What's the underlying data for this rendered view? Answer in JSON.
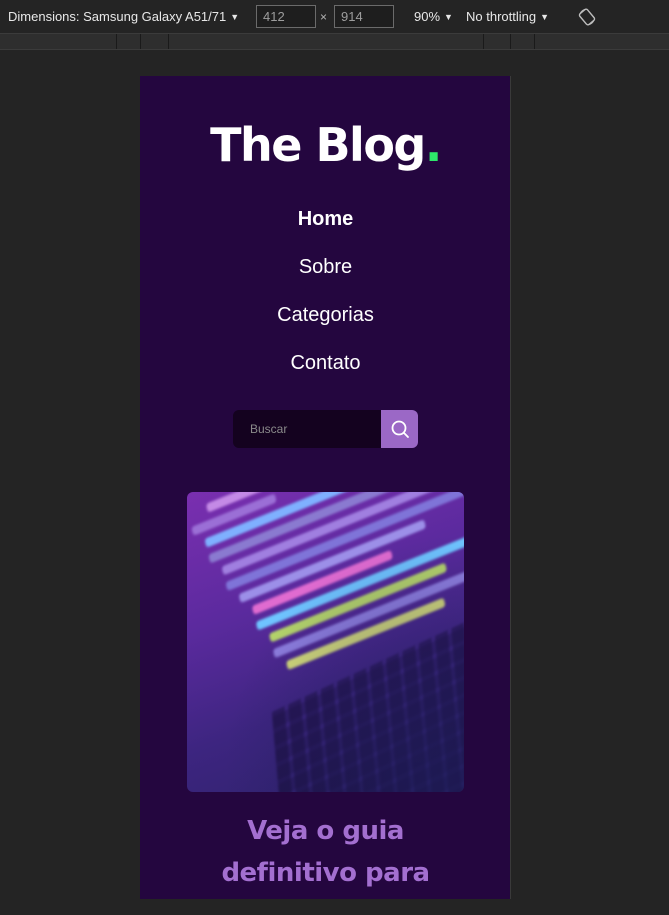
{
  "devtools": {
    "device_label": "Dimensions: Samsung Galaxy A51/71",
    "width_value": "412",
    "height_value": "914",
    "times_sign": "×",
    "zoom": "90%",
    "throttling": "No throttling",
    "caret": "▼",
    "rotate_icon": "rotate-icon"
  },
  "site": {
    "logo_text": "The Blog",
    "logo_dot": ".",
    "accent_color": "#2ee66a",
    "nav": [
      {
        "label": "Home",
        "active": true
      },
      {
        "label": "Sobre",
        "active": false
      },
      {
        "label": "Categorias",
        "active": false
      },
      {
        "label": "Contato",
        "active": false
      }
    ],
    "search": {
      "placeholder": "Buscar",
      "button_icon": "search-icon"
    },
    "hero_image": "code-on-laptop-photo",
    "headline": "Veja o guia definitivo para",
    "headline_lines": [
      "Veja o guia",
      "definitivo para"
    ]
  }
}
